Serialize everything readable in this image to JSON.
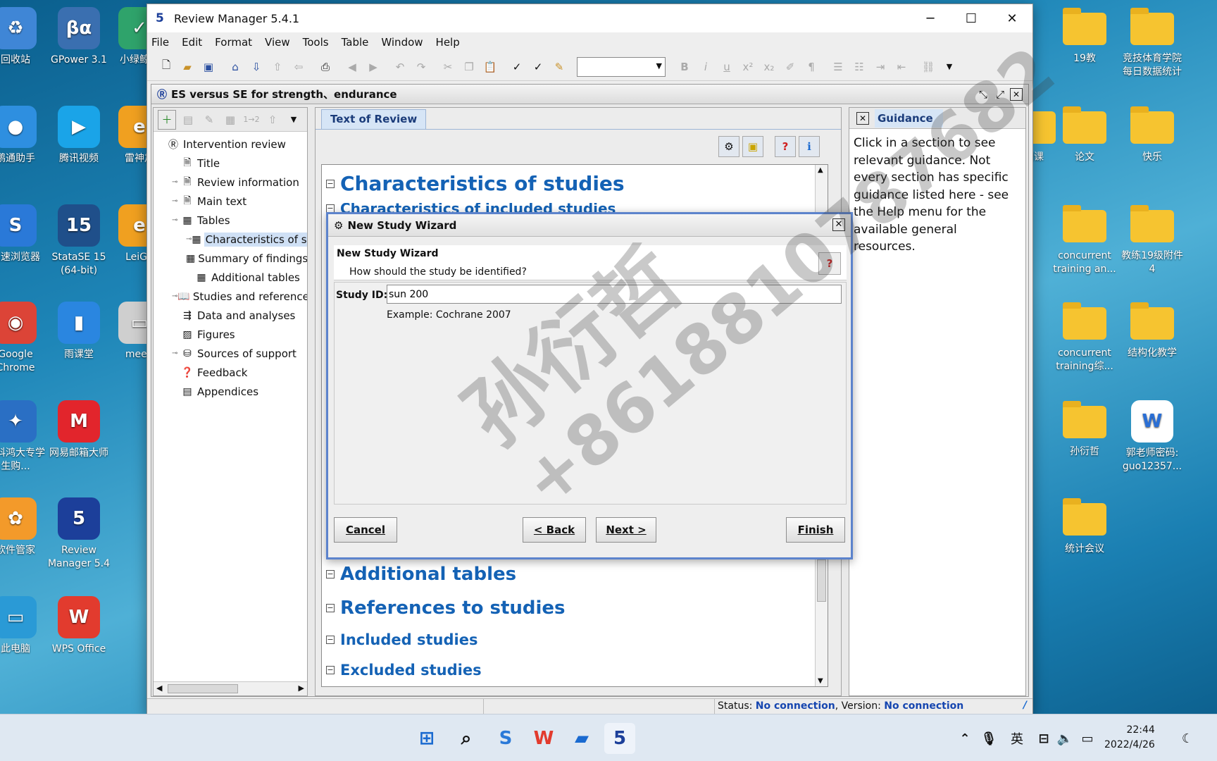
{
  "desktop_left": [
    {
      "name": "回收站",
      "label": "回收站",
      "color": "#3f86d6",
      "glyph": "♻"
    },
    {
      "name": "gpower",
      "label": "GPower 3.1",
      "color": "#3a6fb0",
      "glyph": "βα"
    },
    {
      "name": "xiaolv",
      "label": "小绿鲸读",
      "color": "#2fa36b",
      "glyph": "✓"
    },
    {
      "name": "pengtong",
      "label": "鹏通助手",
      "color": "#2e8fe0",
      "glyph": "●"
    },
    {
      "name": "tencent-video",
      "label": "腾讯视频",
      "color": "#1aa4e8",
      "glyph": "▶"
    },
    {
      "name": "leishen",
      "label": "雷神加",
      "color": "#f0a020",
      "glyph": "e"
    },
    {
      "name": "browser",
      "label": "高速浏览器",
      "color": "#2a79d8",
      "glyph": "S"
    },
    {
      "name": "stata",
      "label": "StataSE 15 (64-bit)",
      "color": "#1f4f8a",
      "glyph": "15"
    },
    {
      "name": "leigu",
      "label": "LeiGu",
      "color": "#f0a020",
      "glyph": "e"
    },
    {
      "name": "chrome",
      "label": "Google Chrome",
      "color": "#dc4437",
      "glyph": "◉"
    },
    {
      "name": "yuketang",
      "label": "雨课堂",
      "color": "#2a86e0",
      "glyph": "▮"
    },
    {
      "name": "meeting",
      "label": "meeti",
      "color": "#cfcfcf",
      "glyph": "▭"
    },
    {
      "name": "keda",
      "label": "大科鸿大专学生购...",
      "color": "#2a6fc4",
      "glyph": "✦"
    },
    {
      "name": "netease-mail",
      "label": "网易邮箱大师",
      "color": "#e2252c",
      "glyph": "M"
    },
    {
      "name": "software-mgr",
      "label": "软件管家",
      "color": "#f39a2a",
      "glyph": "✿"
    },
    {
      "name": "revman",
      "label": "Review Manager 5.4",
      "color": "#1c3f9a",
      "glyph": "5"
    },
    {
      "name": "this-pc",
      "label": "此电脑",
      "color": "#2a9ad6",
      "glyph": "▭"
    },
    {
      "name": "wps",
      "label": "WPS Office",
      "color": "#e23b2e",
      "glyph": "W"
    }
  ],
  "desktop_right": [
    {
      "name": "19jiao",
      "label": "19教"
    },
    {
      "name": "jingji",
      "label": "竞技体育学院每日数据统计"
    },
    {
      "name": "qike",
      "label": "期课"
    },
    {
      "name": "lunwen",
      "label": "论文"
    },
    {
      "name": "kuaile",
      "label": "快乐"
    },
    {
      "name": "concurrent1",
      "label": "concurrent training an..."
    },
    {
      "name": "jiaolian19",
      "label": "教练19级附件4"
    },
    {
      "name": "concurrent2",
      "label": "concurrent training综..."
    },
    {
      "name": "jiegou",
      "label": "结构化教学"
    },
    {
      "name": "sunyanzhe",
      "label": "孙衍哲"
    },
    {
      "name": "guo-pw",
      "label": "郭老师密码: guo12357..."
    },
    {
      "name": "tongji",
      "label": "统计会议"
    }
  ],
  "app": {
    "title": "Review Manager 5.4.1",
    "menu": [
      "File",
      "Edit",
      "Format",
      "View",
      "Tools",
      "Table",
      "Window",
      "Help"
    ],
    "doc_title": "ES versus SE for strength、endurance"
  },
  "tree": {
    "items": [
      {
        "label": "Intervention review",
        "icon": "review-icon",
        "level": 0
      },
      {
        "label": "Title",
        "icon": "page-icon",
        "level": 1
      },
      {
        "label": "Review information",
        "icon": "page-icon",
        "level": 1
      },
      {
        "label": "Main text",
        "icon": "page-icon",
        "level": 1
      },
      {
        "label": "Tables",
        "icon": "table-icon",
        "level": 1
      },
      {
        "label": "Characteristics of stu",
        "icon": "table-icon",
        "level": 2,
        "selected": true
      },
      {
        "label": "Summary of findings",
        "icon": "table-icon",
        "level": 2
      },
      {
        "label": "Additional tables",
        "icon": "table-icon",
        "level": 2
      },
      {
        "label": "Studies and references",
        "icon": "book-icon",
        "level": 1
      },
      {
        "label": "Data and analyses",
        "icon": "data-icon",
        "level": 1
      },
      {
        "label": "Figures",
        "icon": "figure-icon",
        "level": 1
      },
      {
        "label": "Sources of support",
        "icon": "support-icon",
        "level": 1
      },
      {
        "label": "Feedback",
        "icon": "feedback-icon",
        "level": 1
      },
      {
        "label": "Appendices",
        "icon": "appendix-icon",
        "level": 1
      }
    ]
  },
  "main": {
    "tab_label": "Text of Review",
    "sections_top": [
      "Characteristics of studies",
      "Characteristics of included studies"
    ],
    "sections_bottom": [
      "Additional tables",
      "References to studies",
      "Included studies",
      "Excluded studies"
    ]
  },
  "guidance": {
    "tab_label": "Guidance",
    "text": "Click in a section to see relevant guidance. Not every section has specific guidance listed here - see the Help menu for the available general resources."
  },
  "dialog": {
    "title": "New Study Wizard",
    "heading": "New Study Wizard",
    "question": "How should the study be identified?",
    "field_label": "Study ID:",
    "field_value": "sun 200",
    "example": "Example: Cochrane 2007",
    "buttons": {
      "cancel": "Cancel",
      "back": "< Back",
      "next": "Next >",
      "finish": "Finish"
    }
  },
  "status": {
    "label": "Status:",
    "connection": "No connection",
    "version_label": ", Version:",
    "version": "No connection"
  },
  "watermark": {
    "line1": "孙衍哲",
    "line2": "+8618810787682"
  },
  "taskbar": {
    "ime": "英",
    "time": "22:44",
    "date": "2022/4/26"
  }
}
